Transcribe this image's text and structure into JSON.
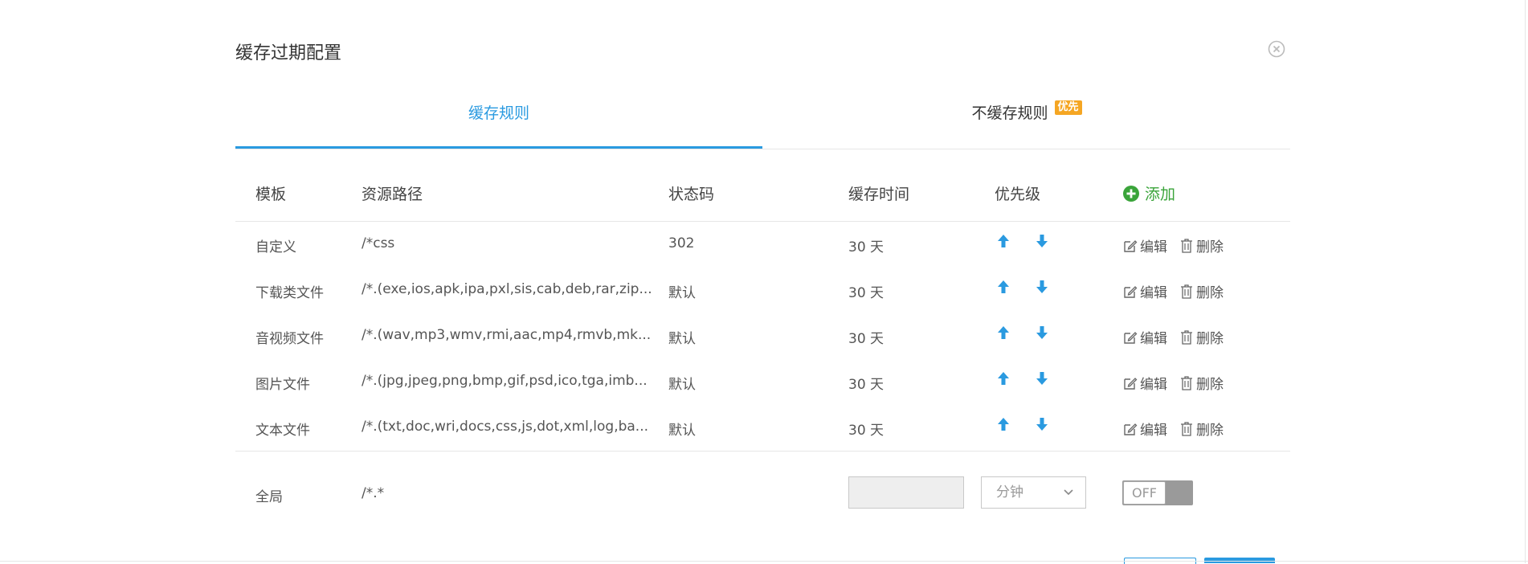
{
  "dialog": {
    "title": "缓存过期配置",
    "close_icon": "close-circle-icon"
  },
  "tabs": [
    {
      "label": "缓存规则",
      "active": true
    },
    {
      "label": "不缓存规则",
      "badge": "优先",
      "active": false
    }
  ],
  "table": {
    "headers": [
      "模板",
      "资源路径",
      "状态码",
      "缓存时间",
      "优先级"
    ],
    "add_label": "添加",
    "rows": [
      {
        "template": "自定义",
        "path": "/*css",
        "status": "302",
        "time": "30 天"
      },
      {
        "template": "下载类文件",
        "path": "/*.(exe,ios,apk,ipa,pxl,sis,cab,deb,rar,zip...",
        "status": "默认",
        "time": "30 天"
      },
      {
        "template": "音视频文件",
        "path": "/*.(wav,mp3,wmv,rmi,aac,mp4,rmvb,mk...",
        "status": "默认",
        "time": "30 天"
      },
      {
        "template": "图片文件",
        "path": "/*.(jpg,jpeg,png,bmp,gif,psd,ico,tga,imb...",
        "status": "默认",
        "time": "30 天"
      },
      {
        "template": "文本文件",
        "path": "/*.(txt,doc,wri,docs,css,js,dot,xml,log,ba...",
        "status": "默认",
        "time": "30 天"
      }
    ],
    "actions": {
      "edit": "编辑",
      "delete": "删除"
    }
  },
  "global": {
    "template": "全局",
    "path": "/*.*",
    "time_value": "",
    "unit": "分钟",
    "toggle": "OFF"
  },
  "colors": {
    "accent": "#2a9ae0",
    "badge": "#f5a623",
    "add_green": "#3aa43a"
  }
}
